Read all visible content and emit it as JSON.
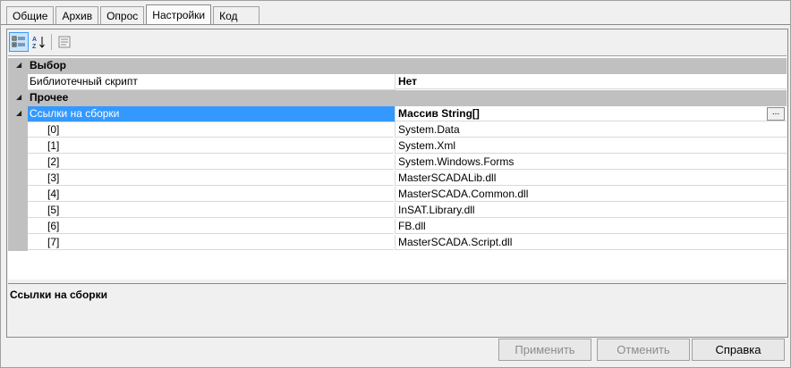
{
  "tabs": [
    {
      "label": "Общие"
    },
    {
      "label": "Архив"
    },
    {
      "label": "Опрос"
    },
    {
      "label": "Настройки"
    },
    {
      "label": "Код"
    }
  ],
  "toolbar": {
    "categorized_icon": "categorized-icon",
    "alphabetical_icon": "sort-alphabetical-icon",
    "pages_icon": "property-pages-icon"
  },
  "grid": {
    "cat1": {
      "label": "Выбор"
    },
    "lib_script": {
      "name": "Библиотечный скрипт",
      "value": "Нет"
    },
    "cat2": {
      "label": "Прочее"
    },
    "refs": {
      "name": "Ссылки на сборки",
      "value": "Массив String[]",
      "ellipsis": "..."
    },
    "items": [
      {
        "index": "[0]",
        "value": "System.Data"
      },
      {
        "index": "[1]",
        "value": "System.Xml"
      },
      {
        "index": "[2]",
        "value": "System.Windows.Forms"
      },
      {
        "index": "[3]",
        "value": "MasterSCADALib.dll"
      },
      {
        "index": "[4]",
        "value": "MasterSCADA.Common.dll"
      },
      {
        "index": "[5]",
        "value": "InSAT.Library.dll"
      },
      {
        "index": "[6]",
        "value": "FB.dll"
      },
      {
        "index": "[7]",
        "value": "MasterSCADA.Script.dll"
      }
    ]
  },
  "description": {
    "title": "Ссылки на сборки"
  },
  "buttons": {
    "apply": "Применить",
    "cancel": "Отменить",
    "help": "Справка"
  }
}
